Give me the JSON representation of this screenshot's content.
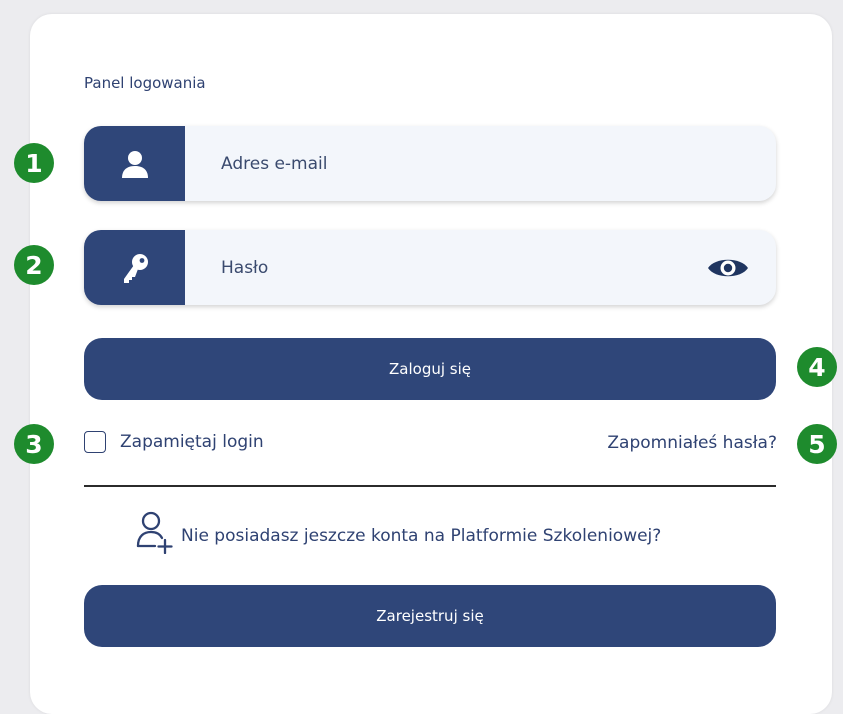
{
  "login_panel": {
    "title": "Panel logowania",
    "email_field": {
      "placeholder": "Adres e-mail",
      "icon": "user-icon"
    },
    "password_field": {
      "placeholder": "Hasło",
      "icon": "key-icon",
      "toggle_icon": "eye-icon"
    },
    "login_button": "Zaloguj się",
    "remember_label": "Zapamiętaj login",
    "remember_checked": false,
    "forgot_link": "Zapomniałeś hasła?",
    "no_account_text": "Nie posiadasz jeszcze konta na Platformie Szkoleniowej?",
    "no_account_icon": "user-plus-icon",
    "register_button": "Zarejestruj się"
  },
  "callouts": [
    "1",
    "2",
    "3",
    "4",
    "5"
  ],
  "colors": {
    "primary": "#2f4679",
    "text": "#2f4272",
    "field_bg": "#f3f6fb",
    "callout": "#1e8b2d",
    "page_bg": "#ececef"
  }
}
